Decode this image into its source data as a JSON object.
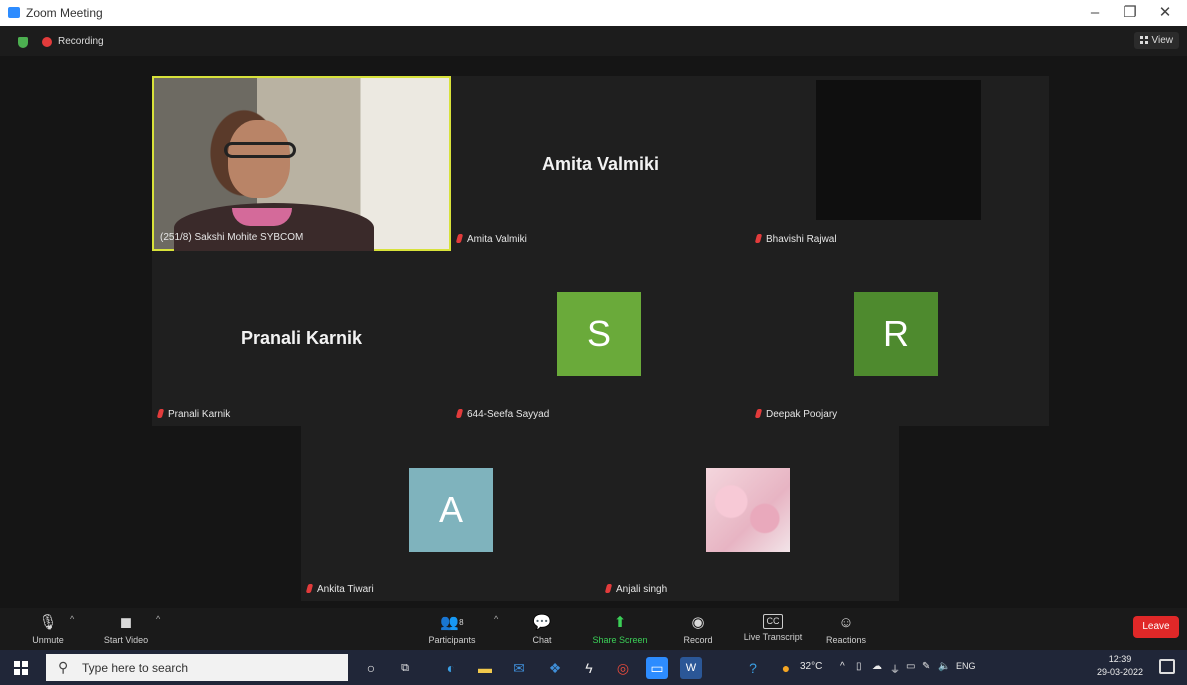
{
  "window": {
    "title": "Zoom Meeting",
    "minimize": "–",
    "maximize": "❐",
    "close": "✕"
  },
  "topbar": {
    "recording_label": "Recording",
    "view_label": "View"
  },
  "tiles": {
    "sakshi": {
      "caption": "(251/8) Sakshi Mohite SYBCOM"
    },
    "amita": {
      "big_name": "Amita Valmiki",
      "caption": "Amita Valmiki"
    },
    "bhavishi": {
      "caption": "Bhavishi Rajwal"
    },
    "pranali": {
      "big_name": "Pranali Karnik",
      "caption": "Pranali Karnik"
    },
    "seefa": {
      "avatar_letter": "S",
      "avatar_color": "#6aaa3a",
      "caption": "644-Seefa Sayyad"
    },
    "deepak": {
      "avatar_letter": "R",
      "avatar_color": "#4e8a2e",
      "caption": "Deepak Poojary"
    },
    "ankita": {
      "avatar_letter": "A",
      "avatar_color": "#7fb3bd",
      "caption": "Ankita Tiwari"
    },
    "anjali": {
      "caption": "Anjali singh"
    }
  },
  "toolbar": {
    "unmute": "Unmute",
    "start_video": "Start Video",
    "participants": "Participants",
    "participants_count": "8",
    "chat": "Chat",
    "share_screen": "Share Screen",
    "record": "Record",
    "live_transcript": "Live Transcript",
    "reactions": "Reactions",
    "leave": "Leave"
  },
  "taskbar": {
    "search_placeholder": "Type here to search",
    "temperature": "32°C",
    "language": "ENG",
    "time": "12:39",
    "date": "29-03-2022"
  }
}
